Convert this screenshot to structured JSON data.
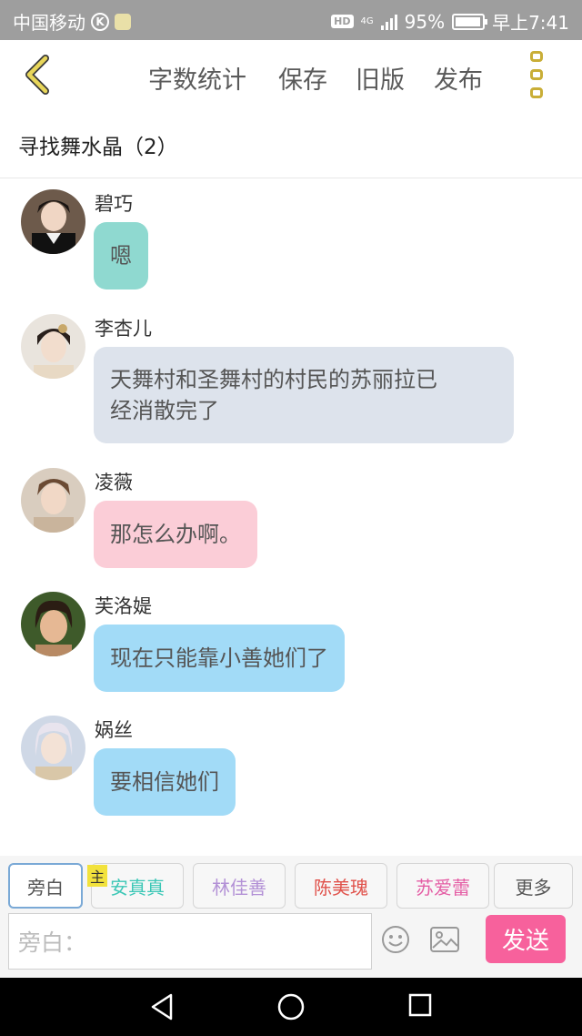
{
  "status_bar": {
    "carrier": "中国移动",
    "k_badge": "K",
    "hd": "HD",
    "network": "4G",
    "battery": "95%",
    "time": "早上7:41",
    "battery_level": 0.95
  },
  "toolbar": {
    "word_count": "字数统计",
    "save": "保存",
    "old_version": "旧版",
    "publish": "发布"
  },
  "story_title": "寻找舞水晶（2）",
  "messages": [
    {
      "speaker": "碧巧",
      "text": "嗯",
      "bubble_color": "#8fd9d0"
    },
    {
      "speaker": "李杏儿",
      "text_line1": "天舞村和圣舞村的村民的苏丽拉已",
      "text_line2": "经消散完了",
      "bubble_color": "#dde3ec"
    },
    {
      "speaker": "凌薇",
      "text": "那怎么办啊。",
      "bubble_color": "#fbcdd7"
    },
    {
      "speaker": "芙洛媞",
      "text": "现在只能靠小善她们了",
      "bubble_color": "#a2dbf7"
    },
    {
      "speaker": "娲丝",
      "text": "要相信她们",
      "bubble_color": "#a2dbf7"
    }
  ],
  "characters": [
    {
      "label": "旁白",
      "color": "#555555"
    },
    {
      "label": "安真真",
      "color": "#3cc7b6"
    },
    {
      "label": "林佳善",
      "color": "#b391d6"
    },
    {
      "label": "陈美瑰",
      "color": "#e0514a"
    },
    {
      "label": "苏爱蕾",
      "color": "#e45da4"
    },
    {
      "label": "更多",
      "color": "#555555"
    }
  ],
  "host_tag": "主",
  "input": {
    "placeholder": "旁白："
  },
  "send_label": "发送",
  "colors": {
    "accent": "#f7619c",
    "menu_gold": "#c9ae37",
    "back_arrow": "#e8d65a"
  }
}
